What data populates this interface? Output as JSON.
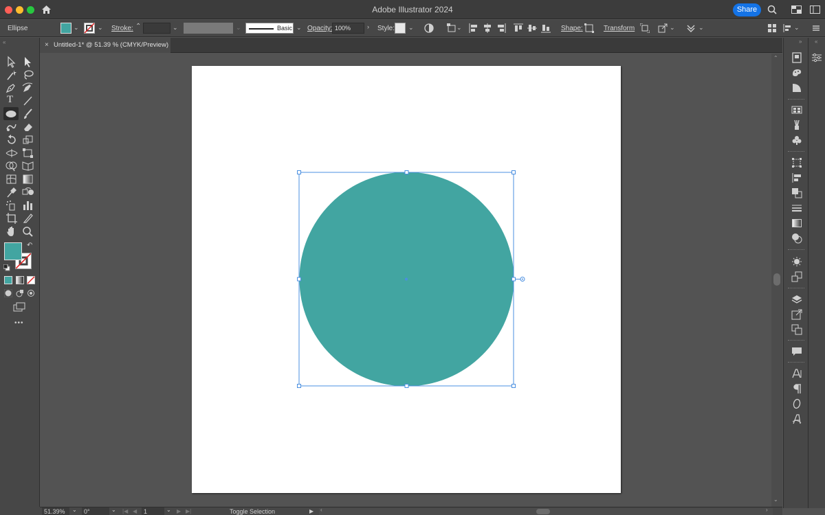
{
  "window": {
    "title": "Adobe Illustrator 2024",
    "share_label": "Share"
  },
  "control_bar": {
    "object_type": "Ellipse",
    "stroke_label": "Stroke:",
    "brush_label": "Basic",
    "opacity_label": "Opacity:",
    "opacity_value": "100%",
    "style_label": "Style:",
    "shape_label": "Shape:",
    "transform_label": "Transform"
  },
  "document_tab": {
    "title": "Untitled-1* @ 51.39 % (CMYK/Preview)",
    "close": "×"
  },
  "status_bar": {
    "zoom": "51.39%",
    "rotation": "0°",
    "artboard_number": "1",
    "tool_status": "Toggle Selection"
  },
  "colors": {
    "fill": "#42a5a1",
    "accent": "#1473e6",
    "selection": "#4a8fe0"
  },
  "more_tools": "•••"
}
